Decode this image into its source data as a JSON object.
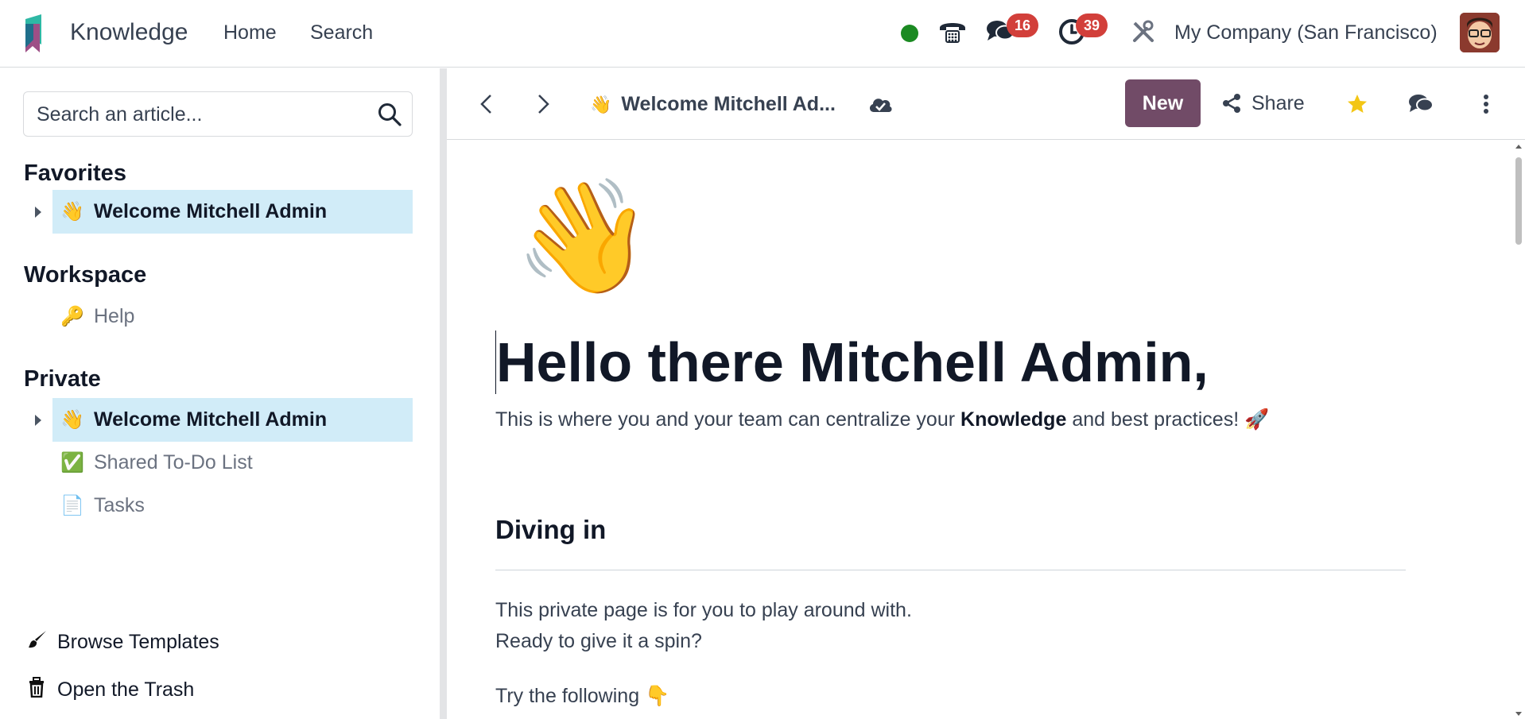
{
  "topbar": {
    "app_name": "Knowledge",
    "menu": [
      "Home",
      "Search"
    ],
    "messages_badge": "16",
    "activities_badge": "39",
    "company": "My Company (San Francisco)",
    "brand_color": "#714b67"
  },
  "sidebar": {
    "search_placeholder": "Search an article...",
    "favorites_title": "Favorites",
    "workspace_title": "Workspace",
    "private_title": "Private",
    "favorites": [
      {
        "emoji": "👋",
        "label": "Welcome Mitchell Admin"
      }
    ],
    "workspace": [
      {
        "emoji": "🔑",
        "label": "Help"
      }
    ],
    "private": [
      {
        "emoji": "👋",
        "label": "Welcome Mitchell Admin"
      },
      {
        "emoji": "✅",
        "label": "Shared To-Do List"
      },
      {
        "emoji": "📄",
        "label": "Tasks"
      }
    ],
    "browse_templates": "Browse Templates",
    "open_trash": "Open the Trash"
  },
  "main": {
    "breadcrumb_emoji": "👋",
    "breadcrumb_title": "Welcome Mitchell Ad...",
    "new_label": "New",
    "share_label": "Share",
    "article": {
      "cover_emoji": "👋",
      "heading": "Hello there Mitchell Admin,",
      "intro_before": "This is where you and your team can centralize your",
      "intro_bold": "Knowledge",
      "intro_after": "and best practices! 🚀",
      "section_title": "Diving in",
      "para1": "This private page is for you to play around with.",
      "para2": "Ready to give it a spin?",
      "para3": "Try the following 👇"
    }
  }
}
